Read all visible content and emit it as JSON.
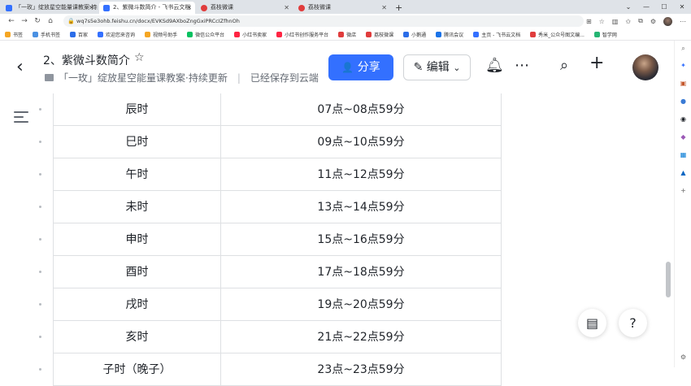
{
  "browser": {
    "tabs": [
      {
        "label": "「一玫」绽放星空能量课教案·持续",
        "active": false,
        "color": "#3370ff"
      },
      {
        "label": "2、紫微斗数简介 - 飞书云文档",
        "active": true,
        "color": "#3370ff"
      },
      {
        "label": "荔枝微课",
        "active": false,
        "color": "#e03c3c"
      },
      {
        "label": "荔枝微课",
        "active": false,
        "color": "#e03c3c"
      }
    ],
    "new_tab": "+",
    "url": "wq7s5e3ohb.feishu.cn/docx/EVKSd9AXboZngGxiPRCcIZfhnOh",
    "bookmarks": [
      {
        "label": "书签",
        "color": "#f5a623"
      },
      {
        "label": "手机书签",
        "color": "#4a90e2"
      },
      {
        "label": "百家",
        "color": "#2b6de8"
      },
      {
        "label": "欢迎您来咨询",
        "color": "#3370ff"
      },
      {
        "label": "视频号助手",
        "color": "#f5a623"
      },
      {
        "label": "微信公众平台",
        "color": "#07c160"
      },
      {
        "label": "小红书卖家",
        "color": "#ff2442"
      },
      {
        "label": "小红书创作服务平台",
        "color": "#ff2442"
      },
      {
        "label": "微店",
        "color": "#e03c3c"
      },
      {
        "label": "荔枝微课",
        "color": "#e03c3c"
      },
      {
        "label": "小鹅通",
        "color": "#2b6de8"
      },
      {
        "label": "腾讯会议",
        "color": "#1a73e8"
      },
      {
        "label": "主页 - 飞书云文档",
        "color": "#3370ff"
      },
      {
        "label": "秀米_公众号图文编...",
        "color": "#e03c3c"
      },
      {
        "label": "智学网",
        "color": "#26b573"
      }
    ]
  },
  "doc": {
    "title": "2、紫微斗数简介",
    "breadcrumb": "「一玫」绽放星空能量课教案·持续更新",
    "save_status": "已经保存到云端",
    "share_label": "分享",
    "edit_label": "编辑"
  },
  "table": {
    "rows": [
      {
        "name": "辰时",
        "time": "07点~08点59分"
      },
      {
        "name": "巳时",
        "time": "09点~10点59分"
      },
      {
        "name": "午时",
        "time": "11点~12点59分"
      },
      {
        "name": "未时",
        "time": "13点~14点59分"
      },
      {
        "name": "申时",
        "time": "15点~16点59分"
      },
      {
        "name": "酉时",
        "time": "17点~18点59分"
      },
      {
        "name": "戌时",
        "time": "19点~20点59分"
      },
      {
        "name": "亥时",
        "time": "21点~22点59分"
      },
      {
        "name": "子时（晚子）",
        "time": "23点~23点59分"
      }
    ]
  }
}
